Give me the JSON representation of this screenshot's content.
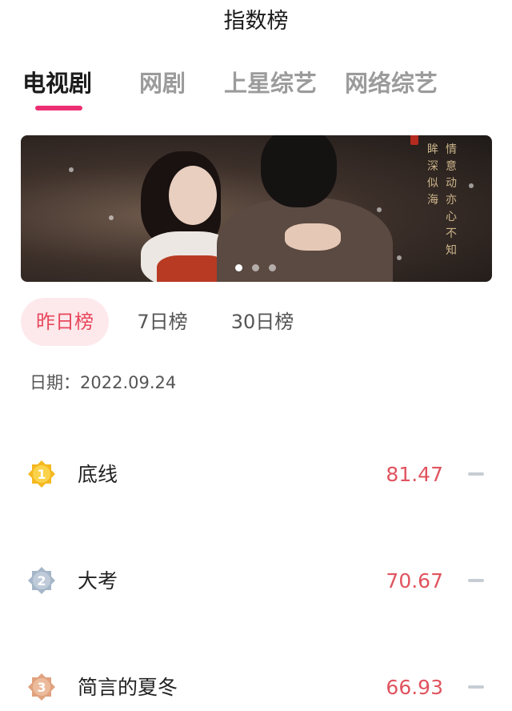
{
  "header": {
    "title": "指数榜"
  },
  "category_tabs": [
    {
      "label": "电视剧",
      "active": true
    },
    {
      "label": "网剧",
      "active": false
    },
    {
      "label": "上星综艺",
      "active": false
    },
    {
      "label": "网络综艺",
      "active": false
    }
  ],
  "banner": {
    "poem_right": "情意动亦心不知",
    "poem_left": "眸深似海",
    "page_count": 3,
    "current_page": 1
  },
  "period_tabs": [
    {
      "label": "昨日榜",
      "active": true
    },
    {
      "label": "7日榜",
      "active": false
    },
    {
      "label": "30日榜",
      "active": false
    }
  ],
  "date": {
    "label": "日期：",
    "value": "2022.09.24"
  },
  "ranking": [
    {
      "rank": "1",
      "name": "底线",
      "score": "81.47",
      "trend": "flat",
      "badge_color": "#f5b820"
    },
    {
      "rank": "2",
      "name": "大考",
      "score": "70.67",
      "trend": "flat",
      "badge_color": "#a6b6c9"
    },
    {
      "rank": "3",
      "name": "简言的夏冬",
      "score": "66.93",
      "trend": "flat",
      "badge_color": "#e0a27e"
    }
  ],
  "colors": {
    "accent": "#ec2f72",
    "score": "#e0545f",
    "active_chip_bg": "#fde9ec",
    "active_chip_text": "#e8485c"
  }
}
